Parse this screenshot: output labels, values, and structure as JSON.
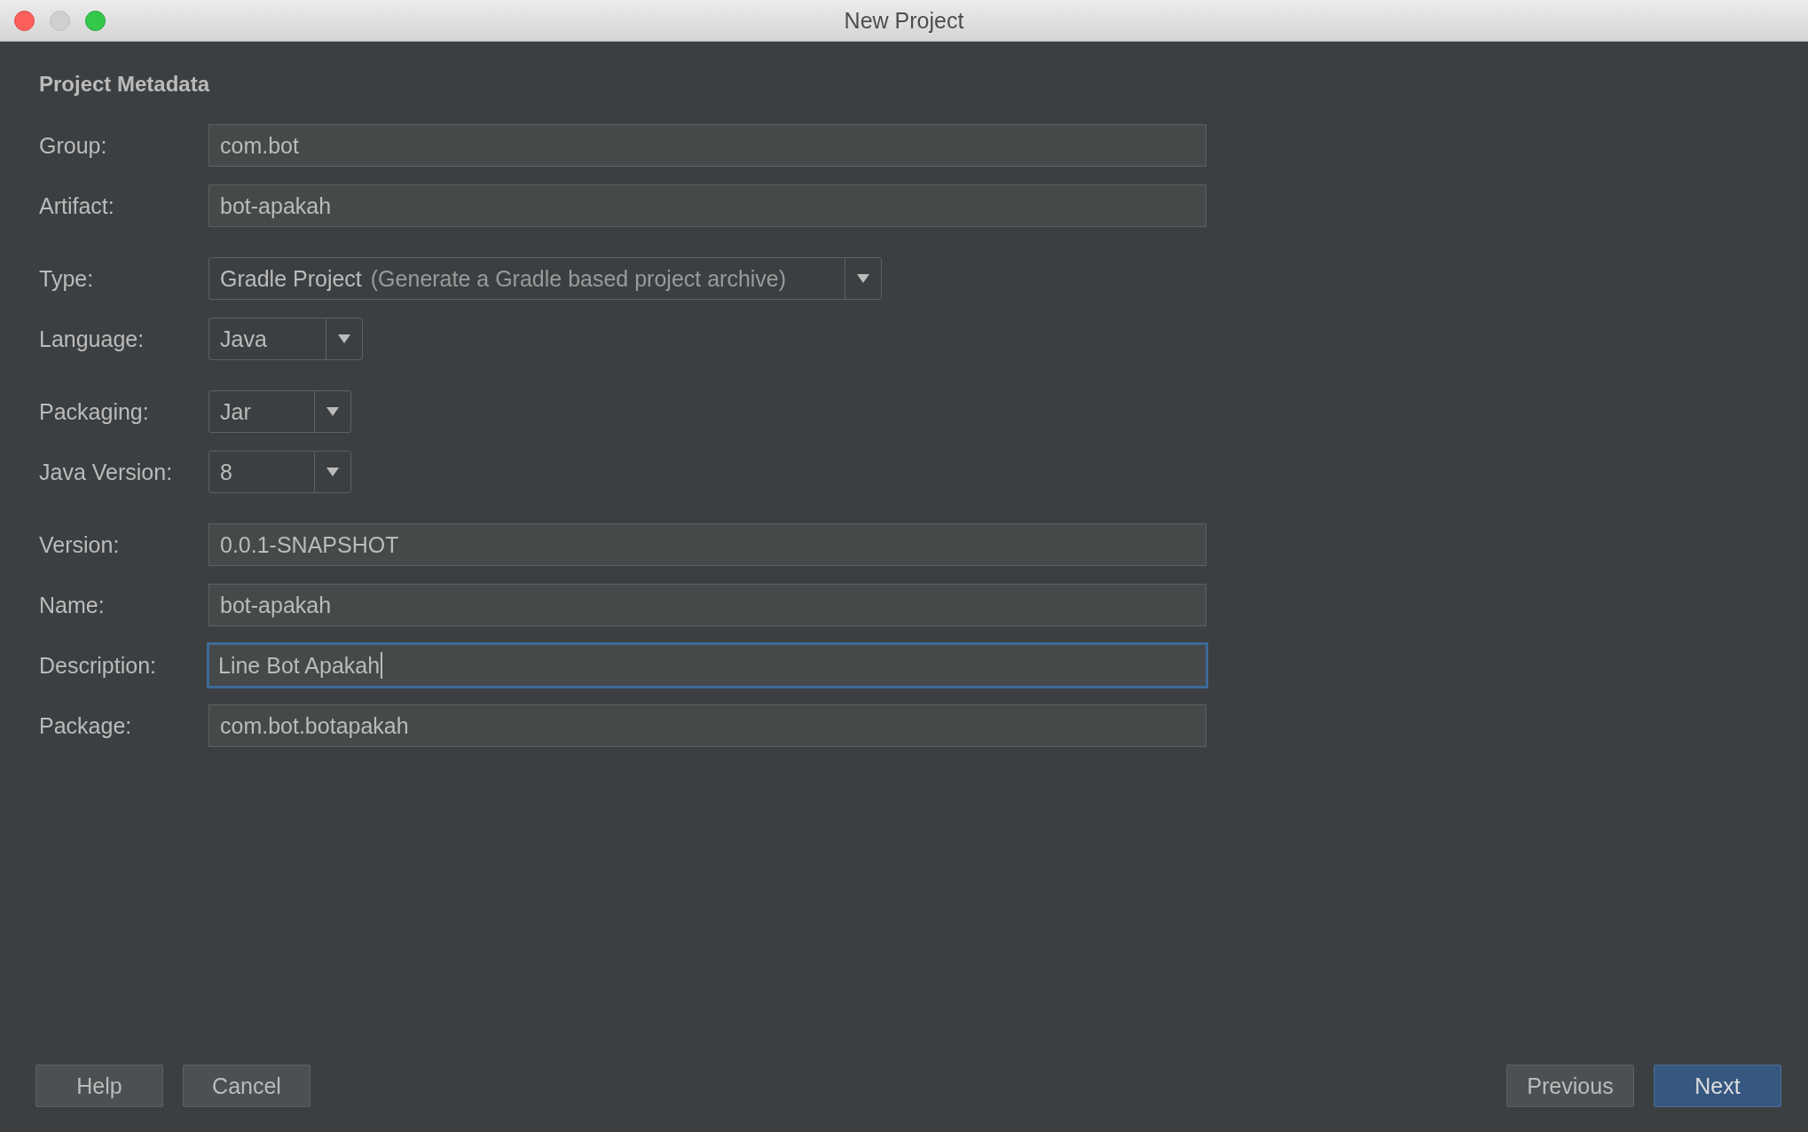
{
  "window": {
    "title": "New Project"
  },
  "heading": "Project Metadata",
  "groups": [
    [
      {
        "label": "Group:",
        "kind": "text",
        "value": "com.bot",
        "focused": false
      },
      {
        "label": "Artifact:",
        "kind": "text",
        "value": "bot-apakah",
        "focused": false
      }
    ],
    [
      {
        "label": "Type:",
        "kind": "dropdown",
        "value": "Gradle Project",
        "hint": "(Generate a Gradle based project archive)"
      },
      {
        "label": "Language:",
        "kind": "dropdown",
        "value": "Java"
      }
    ],
    [
      {
        "label": "Packaging:",
        "kind": "dropdown",
        "value": "Jar"
      },
      {
        "label": "Java Version:",
        "kind": "dropdown",
        "value": "8"
      }
    ],
    [
      {
        "label": "Version:",
        "kind": "text",
        "value": "0.0.1-SNAPSHOT",
        "focused": false
      },
      {
        "label": "Name:",
        "kind": "text",
        "value": "bot-apakah",
        "focused": false
      },
      {
        "label": "Description:",
        "kind": "text",
        "value": "Line Bot Apakah",
        "focused": true
      },
      {
        "label": "Package:",
        "kind": "text",
        "value": "com.bot.botapakah",
        "focused": false
      }
    ]
  ],
  "buttons": {
    "left": [
      {
        "label": "Help",
        "primary": false
      },
      {
        "label": "Cancel",
        "primary": false
      }
    ],
    "right": [
      {
        "label": "Previous",
        "primary": false
      },
      {
        "label": "Next",
        "primary": true
      }
    ]
  }
}
